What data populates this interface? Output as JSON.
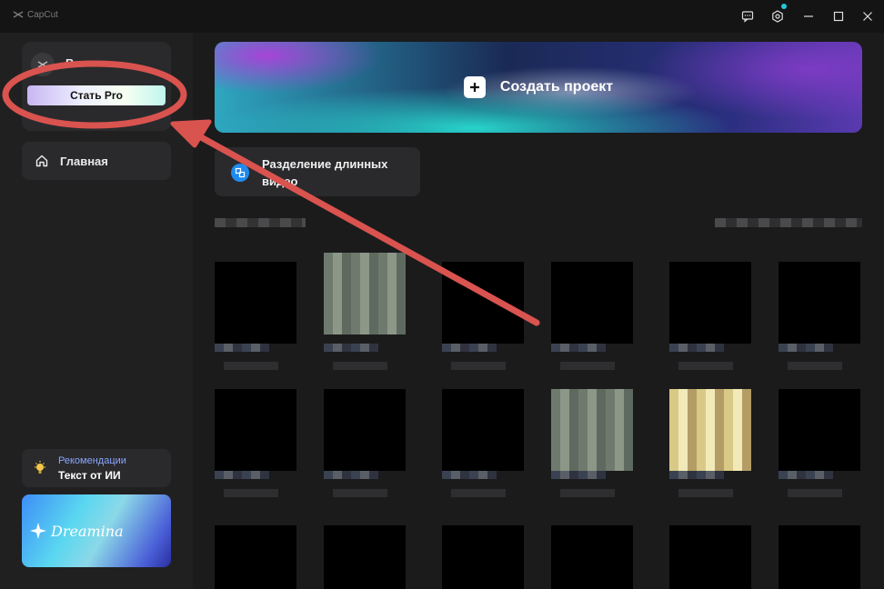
{
  "app": {
    "title": "CapCut"
  },
  "titlebar": {
    "icons": [
      "feedback-icon",
      "settings-icon",
      "minimize-icon",
      "maximize-icon",
      "close-icon"
    ]
  },
  "sidebar": {
    "profile_name": "В",
    "pro_button": "Стать Pro",
    "nav": [
      {
        "label": "Главная",
        "icon": "home-icon"
      }
    ],
    "tips": {
      "category": "Рекомендации",
      "title": "Текст от ИИ"
    },
    "promo": {
      "label": "Dreamina"
    }
  },
  "main": {
    "create_project": "Создать проект",
    "split_video": "Разделение длинных видео"
  },
  "colors": {
    "accent": "#1f8bf0",
    "annotation": "#d9534f",
    "background": "#1b1b1c",
    "sidebar": "#202021"
  }
}
